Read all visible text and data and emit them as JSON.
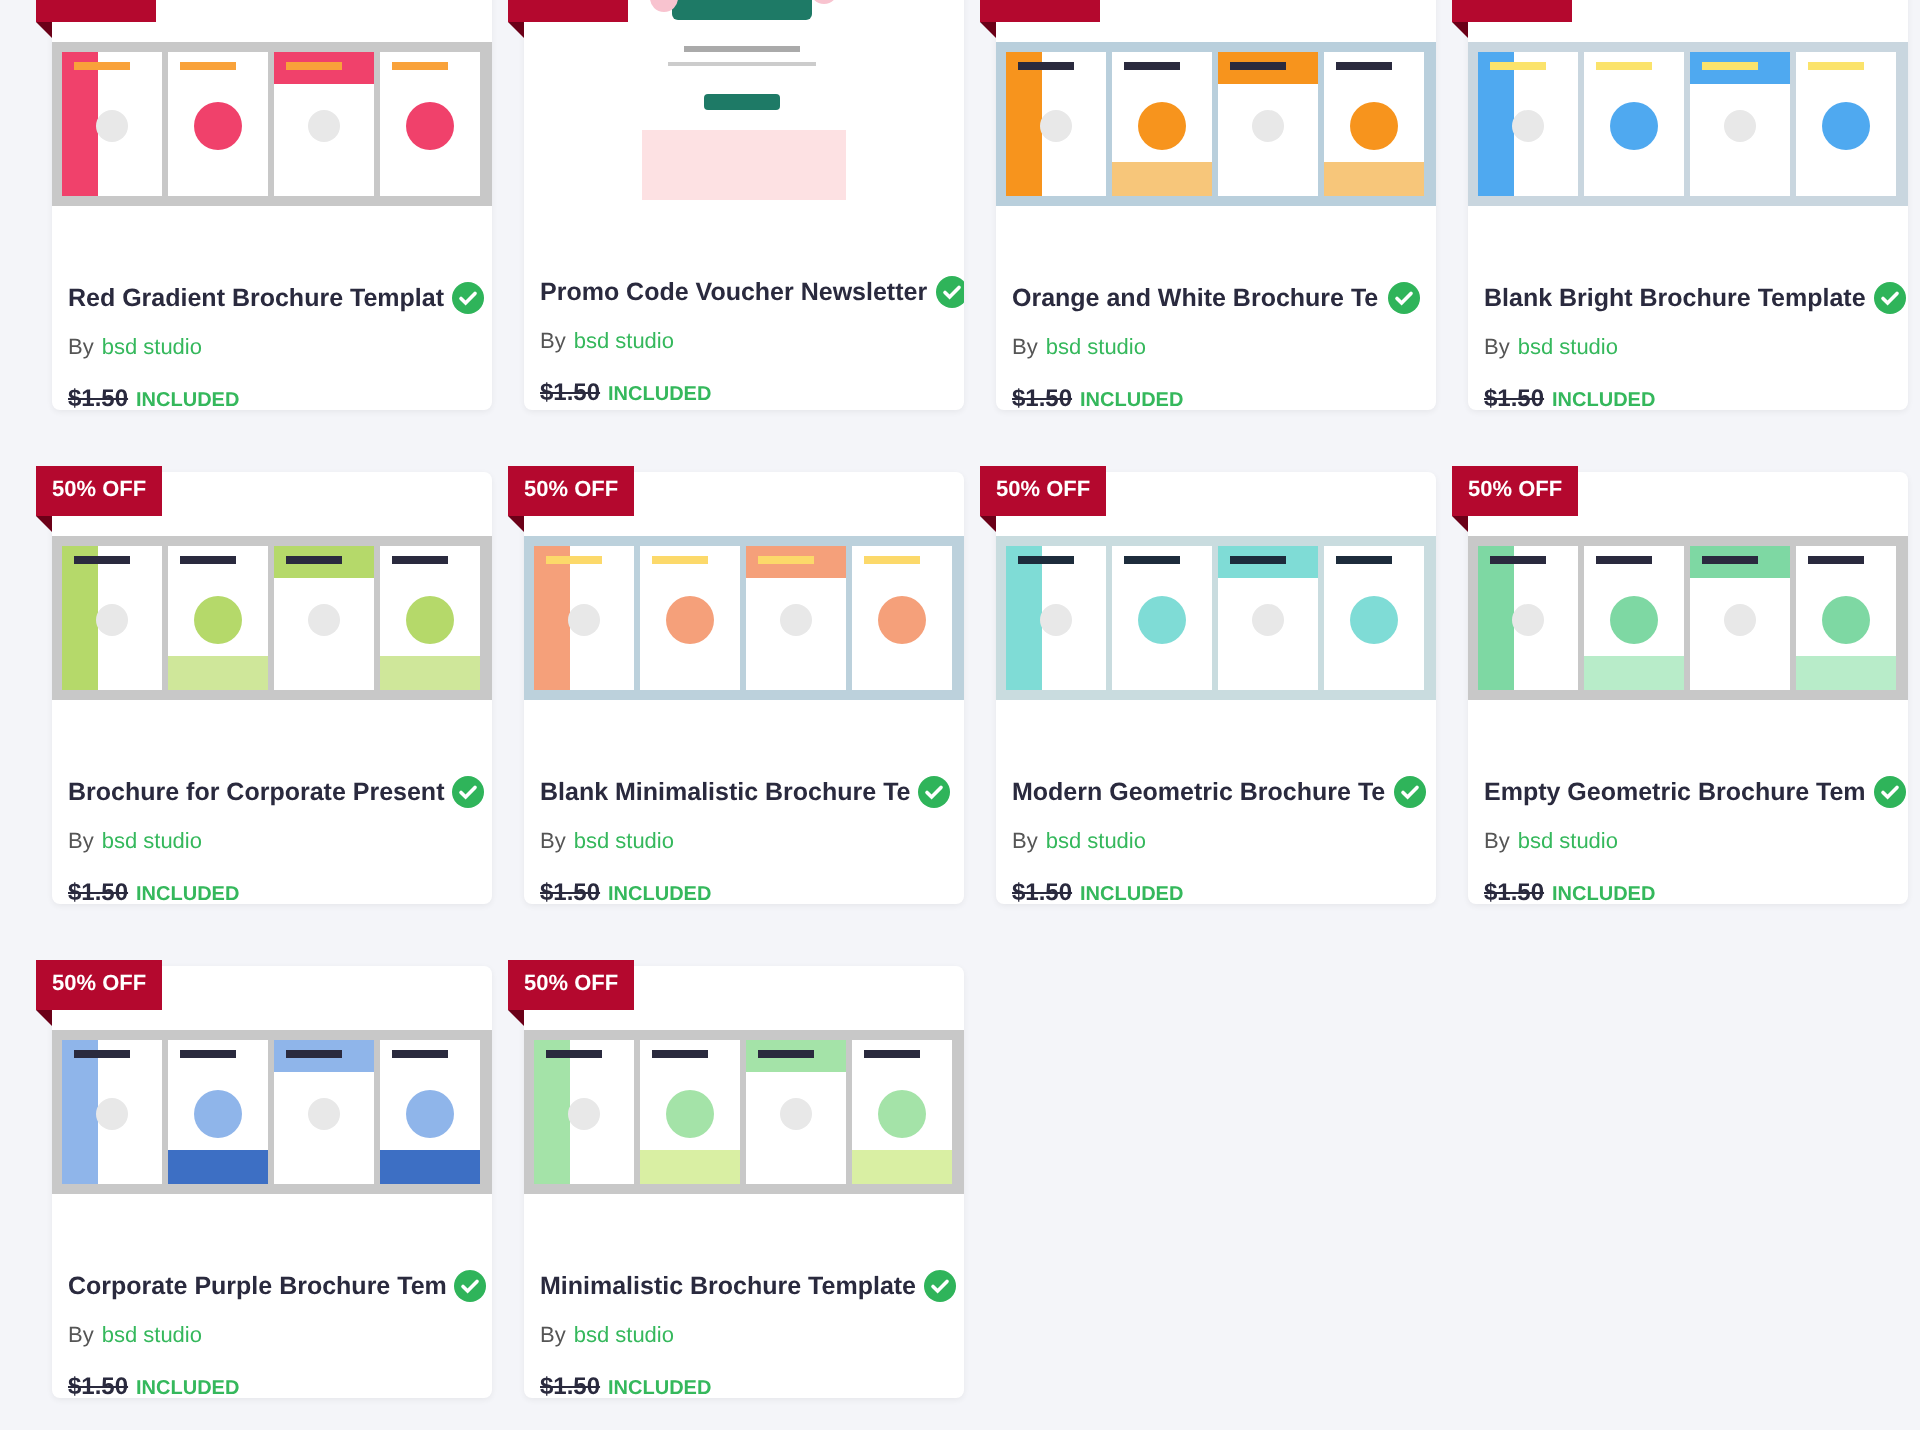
{
  "products": [
    {
      "kind": "brochure",
      "ribbon": true,
      "title": "Red Gradient Brochure Templat",
      "verified": true,
      "by": "By",
      "author": "bsd studio",
      "old_price": "$1.50",
      "status": "INCLUDED"
    },
    {
      "kind": "newsletter",
      "ribbon": true,
      "title": "Promo Code Voucher Newsletter",
      "verified": true,
      "by": "By",
      "author": "bsd studio",
      "old_price": "$1.50",
      "status": "INCLUDED"
    },
    {
      "kind": "brochure",
      "ribbon": true,
      "title": "Orange and White Brochure Te",
      "verified": true,
      "by": "By",
      "author": "bsd studio",
      "old_price": "$1.50",
      "status": "INCLUDED"
    },
    {
      "kind": "brochure",
      "ribbon": true,
      "title": "Blank Bright Brochure Template",
      "verified": true,
      "by": "By",
      "author": "bsd studio",
      "old_price": "$1.50",
      "status": "INCLUDED"
    },
    {
      "kind": "brochure",
      "badge": "50% OFF",
      "title": "Brochure for Corporate Present",
      "verified": true,
      "by": "By",
      "author": "bsd studio",
      "old_price": "$1.50",
      "status": "INCLUDED"
    },
    {
      "kind": "brochure",
      "badge": "50% OFF",
      "title": "Blank Minimalistic Brochure Te",
      "verified": true,
      "by": "By",
      "author": "bsd studio",
      "old_price": "$1.50",
      "status": "INCLUDED"
    },
    {
      "kind": "brochure",
      "badge": "50% OFF",
      "title": "Modern Geometric Brochure Te",
      "verified": true,
      "by": "By",
      "author": "bsd studio",
      "old_price": "$1.50",
      "status": "INCLUDED"
    },
    {
      "kind": "brochure",
      "badge": "50% OFF",
      "title": "Empty Geometric Brochure Tem",
      "verified": true,
      "by": "By",
      "author": "bsd studio",
      "old_price": "$1.50",
      "status": "INCLUDED"
    },
    {
      "kind": "brochure",
      "badge": "50% OFF",
      "title": "Corporate Purple Brochure Tem",
      "verified": true,
      "by": "By",
      "author": "bsd studio",
      "old_price": "$1.50",
      "status": "INCLUDED"
    },
    {
      "kind": "brochure",
      "badge": "50% OFF",
      "title": "Minimalistic Brochure Template",
      "verified": true,
      "by": "By",
      "author": "bsd studio",
      "old_price": "$1.50",
      "status": "INCLUDED"
    }
  ]
}
